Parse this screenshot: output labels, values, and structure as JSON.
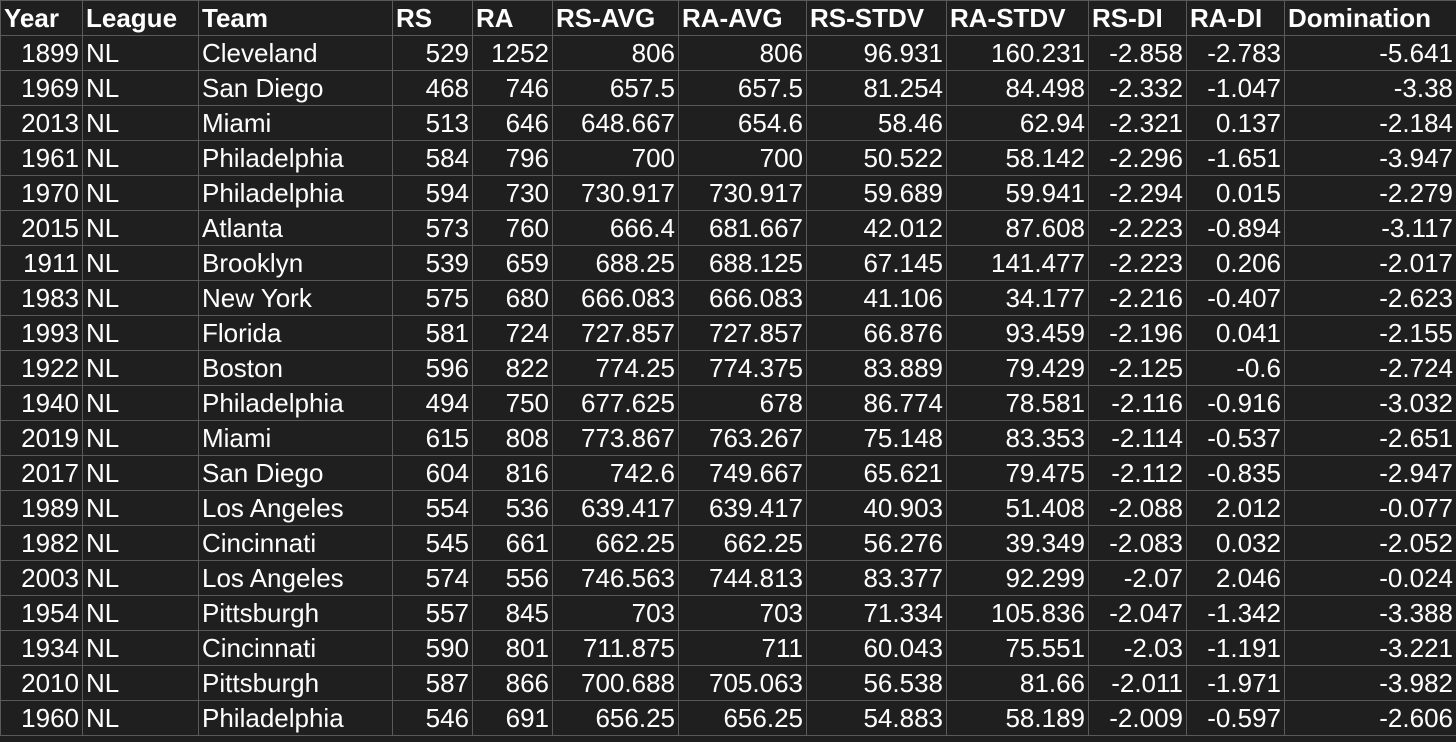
{
  "columns": [
    "Year",
    "League",
    "Team",
    "RS",
    "RA",
    "RS-AVG",
    "RA-AVG",
    "RS-STDV",
    "RA-STDV",
    "RS-DI",
    "RA-DI",
    "Domination"
  ],
  "rows": [
    [
      "1899",
      "NL",
      "Cleveland",
      "529",
      "1252",
      "806",
      "806",
      "96.931",
      "160.231",
      "-2.858",
      "-2.783",
      "-5.641"
    ],
    [
      "1969",
      "NL",
      "San Diego",
      "468",
      "746",
      "657.5",
      "657.5",
      "81.254",
      "84.498",
      "-2.332",
      "-1.047",
      "-3.38"
    ],
    [
      "2013",
      "NL",
      "Miami",
      "513",
      "646",
      "648.667",
      "654.6",
      "58.46",
      "62.94",
      "-2.321",
      "0.137",
      "-2.184"
    ],
    [
      "1961",
      "NL",
      "Philadelphia",
      "584",
      "796",
      "700",
      "700",
      "50.522",
      "58.142",
      "-2.296",
      "-1.651",
      "-3.947"
    ],
    [
      "1970",
      "NL",
      "Philadelphia",
      "594",
      "730",
      "730.917",
      "730.917",
      "59.689",
      "59.941",
      "-2.294",
      "0.015",
      "-2.279"
    ],
    [
      "2015",
      "NL",
      "Atlanta",
      "573",
      "760",
      "666.4",
      "681.667",
      "42.012",
      "87.608",
      "-2.223",
      "-0.894",
      "-3.117"
    ],
    [
      "1911",
      "NL",
      "Brooklyn",
      "539",
      "659",
      "688.25",
      "688.125",
      "67.145",
      "141.477",
      "-2.223",
      "0.206",
      "-2.017"
    ],
    [
      "1983",
      "NL",
      "New York",
      "575",
      "680",
      "666.083",
      "666.083",
      "41.106",
      "34.177",
      "-2.216",
      "-0.407",
      "-2.623"
    ],
    [
      "1993",
      "NL",
      "Florida",
      "581",
      "724",
      "727.857",
      "727.857",
      "66.876",
      "93.459",
      "-2.196",
      "0.041",
      "-2.155"
    ],
    [
      "1922",
      "NL",
      "Boston",
      "596",
      "822",
      "774.25",
      "774.375",
      "83.889",
      "79.429",
      "-2.125",
      "-0.6",
      "-2.724"
    ],
    [
      "1940",
      "NL",
      "Philadelphia",
      "494",
      "750",
      "677.625",
      "678",
      "86.774",
      "78.581",
      "-2.116",
      "-0.916",
      "-3.032"
    ],
    [
      "2019",
      "NL",
      "Miami",
      "615",
      "808",
      "773.867",
      "763.267",
      "75.148",
      "83.353",
      "-2.114",
      "-0.537",
      "-2.651"
    ],
    [
      "2017",
      "NL",
      "San Diego",
      "604",
      "816",
      "742.6",
      "749.667",
      "65.621",
      "79.475",
      "-2.112",
      "-0.835",
      "-2.947"
    ],
    [
      "1989",
      "NL",
      "Los Angeles",
      "554",
      "536",
      "639.417",
      "639.417",
      "40.903",
      "51.408",
      "-2.088",
      "2.012",
      "-0.077"
    ],
    [
      "1982",
      "NL",
      "Cincinnati",
      "545",
      "661",
      "662.25",
      "662.25",
      "56.276",
      "39.349",
      "-2.083",
      "0.032",
      "-2.052"
    ],
    [
      "2003",
      "NL",
      "Los Angeles",
      "574",
      "556",
      "746.563",
      "744.813",
      "83.377",
      "92.299",
      "-2.07",
      "2.046",
      "-0.024"
    ],
    [
      "1954",
      "NL",
      "Pittsburgh",
      "557",
      "845",
      "703",
      "703",
      "71.334",
      "105.836",
      "-2.047",
      "-1.342",
      "-3.388"
    ],
    [
      "1934",
      "NL",
      "Cincinnati",
      "590",
      "801",
      "711.875",
      "711",
      "60.043",
      "75.551",
      "-2.03",
      "-1.191",
      "-3.221"
    ],
    [
      "2010",
      "NL",
      "Pittsburgh",
      "587",
      "866",
      "700.688",
      "705.063",
      "56.538",
      "81.66",
      "-2.011",
      "-1.971",
      "-3.982"
    ],
    [
      "1960",
      "NL",
      "Philadelphia",
      "546",
      "691",
      "656.25",
      "656.25",
      "54.883",
      "58.189",
      "-2.009",
      "-0.597",
      "-2.606"
    ]
  ]
}
